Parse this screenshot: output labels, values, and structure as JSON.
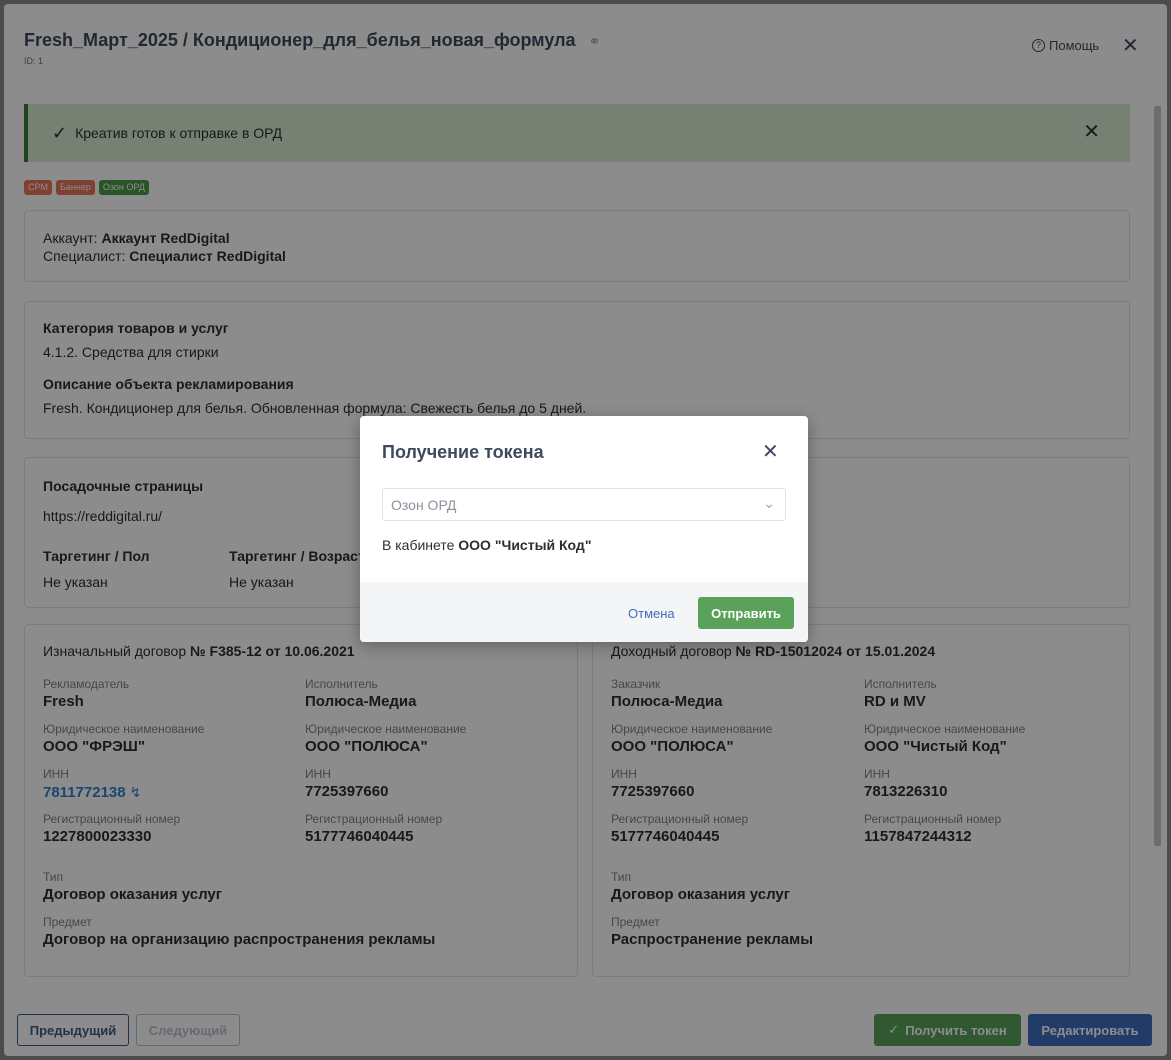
{
  "header": {
    "title": "Fresh_Март_2025 / Кондиционер_для_белья_новая_формула",
    "id_label": "ID: 1",
    "help_label": "Помощь"
  },
  "alert": {
    "text": "Креатив готов к отправке в ОРД"
  },
  "badges": [
    {
      "label": "CPM",
      "color": "#e8735a"
    },
    {
      "label": "Баннер",
      "color": "#e8735a"
    },
    {
      "label": "Озон ОРД",
      "color": "#4a9a4a"
    }
  ],
  "account": {
    "account_label": "Аккаунт:",
    "account_value": "Аккаунт RedDigital",
    "specialist_label": "Специалист:",
    "specialist_value": "Специалист RedDigital"
  },
  "category": {
    "heading": "Категория товаров и услуг",
    "value": "4.1.2. Средства для стирки",
    "desc_heading": "Описание объекта рекламирования",
    "desc_value": "Fresh. Кондиционер для белья. Обновленная формула: Свежесть белья до 5 дней."
  },
  "landing": {
    "heading": "Посадочные страницы",
    "url": "https://reddigital.ru/",
    "gender_heading": "Таргетинг / Пол",
    "gender_value": "Не указан",
    "age_heading": "Таргетинг / Возраст",
    "age_value": "Не указан"
  },
  "contract_left": {
    "prefix": "Изначальный договор",
    "number": "№ F385-12 от 10.06.2021",
    "col1": {
      "role_label": "Рекламодатель",
      "role_value": "Fresh",
      "legal_label": "Юридическое наименование",
      "legal_value": "ООО \"ФРЭШ\"",
      "inn_label": "ИНН",
      "inn_value": "7811772138",
      "reg_label": "Регистрационный номер",
      "reg_value": "1227800023330"
    },
    "col2": {
      "role_label": "Исполнитель",
      "role_value": "Полюса-Медиа",
      "legal_label": "Юридическое наименование",
      "legal_value": "ООО \"ПОЛЮСА\"",
      "inn_label": "ИНН",
      "inn_value": "7725397660",
      "reg_label": "Регистрационный номер",
      "reg_value": "5177746040445"
    },
    "type_label": "Тип",
    "type_value": "Договор оказания услуг",
    "subject_label": "Предмет",
    "subject_value": "Договор на организацию распространения рекламы"
  },
  "contract_right": {
    "prefix": "Доходный договор",
    "number": "№ RD-15012024 от 15.01.2024",
    "col1": {
      "role_label": "Заказчик",
      "role_value": "Полюса-Медиа",
      "legal_label": "Юридическое наименование",
      "legal_value": "ООО \"ПОЛЮСА\"",
      "inn_label": "ИНН",
      "inn_value": "7725397660",
      "reg_label": "Регистрационный номер",
      "reg_value": "5177746040445"
    },
    "col2": {
      "role_label": "Исполнитель",
      "role_value": "RD и MV",
      "legal_label": "Юридическое наименование",
      "legal_value": "ООО \"Чистый Код\"",
      "inn_label": "ИНН",
      "inn_value": "7813226310",
      "reg_label": "Регистрационный номер",
      "reg_value": "1157847244312"
    },
    "type_label": "Тип",
    "type_value": "Договор оказания услуг",
    "subject_label": "Предмет",
    "subject_value": "Распространение рекламы"
  },
  "footer": {
    "prev_label": "Предыдущий",
    "next_label": "Следующий",
    "get_token_label": "Получить токен",
    "edit_label": "Редактировать"
  },
  "modal": {
    "title": "Получение токена",
    "select_value": "Озон ОРД",
    "cabinet_prefix": "В кабинете",
    "cabinet_name": "ООО \"Чистый Код\"",
    "cancel_label": "Отмена",
    "send_label": "Отправить"
  }
}
